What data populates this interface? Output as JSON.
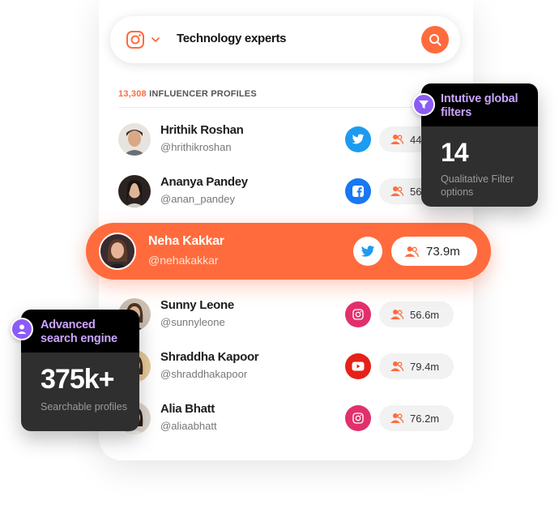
{
  "search": {
    "platform_icon": "instagram-icon",
    "query": "Technology experts"
  },
  "results": {
    "count": "13,308",
    "label": "INFLUENCER PROFILES"
  },
  "profiles": [
    {
      "name": "Hrithik Roshan",
      "handle": "@hrithikroshan",
      "platform": "twitter-icon",
      "followers": "44"
    },
    {
      "name": "Ananya Pandey",
      "handle": "@anan_pandey",
      "platform": "facebook-icon",
      "followers": "56"
    },
    {
      "name": "Neha Kakkar",
      "handle": "@nehakakkar",
      "platform": "twitter-icon",
      "followers": "73.9m"
    },
    {
      "name": "Sunny Leone",
      "handle": "@sunnyleone",
      "platform": "instagram-icon",
      "followers": "56.6m"
    },
    {
      "name": "Shraddha Kapoor",
      "handle": "@shraddhakapoor",
      "platform": "youtube-icon",
      "followers": "79.4m"
    },
    {
      "name": "Alia Bhatt",
      "handle": "@aliaabhatt",
      "platform": "instagram-icon",
      "followers": "76.2m"
    }
  ],
  "filters_panel": {
    "title": "Intutive global filters",
    "value": "14",
    "caption": "Qualitative Filter options"
  },
  "search_panel": {
    "title": "Advanced search engine",
    "value": "375k+",
    "caption": "Searchable profiles"
  },
  "colors": {
    "accent": "#ff6b3d",
    "purple": "#8b5cf6",
    "twitter": "#1d9bf0",
    "facebook": "#1877f2",
    "instagram": "#e1306c",
    "youtube": "#e62117"
  }
}
